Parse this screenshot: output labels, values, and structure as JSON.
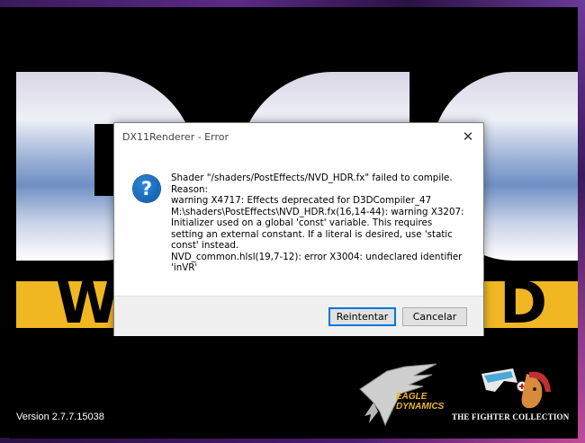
{
  "splash": {
    "band_letter_left": "W",
    "band_letter_right": "D",
    "version": "Version 2.7.7.15038",
    "eagle_logo_text_line1": "EAGLE",
    "eagle_logo_text_line2": "DYNAMICS",
    "tfc_text": "THE FIGHTER COLLECTION",
    "colors": {
      "band": "#f0b722",
      "background": "#000000"
    }
  },
  "dialog": {
    "title": "DX11Renderer - Error",
    "close_icon": "close-icon",
    "icon": "question-icon",
    "icon_glyph": "?",
    "message_lines": [
      "Shader \"/shaders/PostEffects/NVD_HDR.fx\" failed to compile.",
      "Reason:",
      "warning X4717: Effects deprecated for D3DCompiler_47",
      "M:\\shaders\\PostEffects\\NVD_HDR.fx(16,14-44): warning X3207:",
      "Initializer used on a global 'const' variable. This requires",
      "setting an external constant. If a literal is desired, use 'static",
      "const' instead.",
      "NVD_common.hlsl(19,7-12): error X3004: undeclared identifier",
      "'inVR'"
    ],
    "buttons": {
      "retry": "Reintentar",
      "cancel": "Cancelar"
    },
    "colors": {
      "focus_border": "#0078d7",
      "footer": "#f0f0f0"
    }
  }
}
